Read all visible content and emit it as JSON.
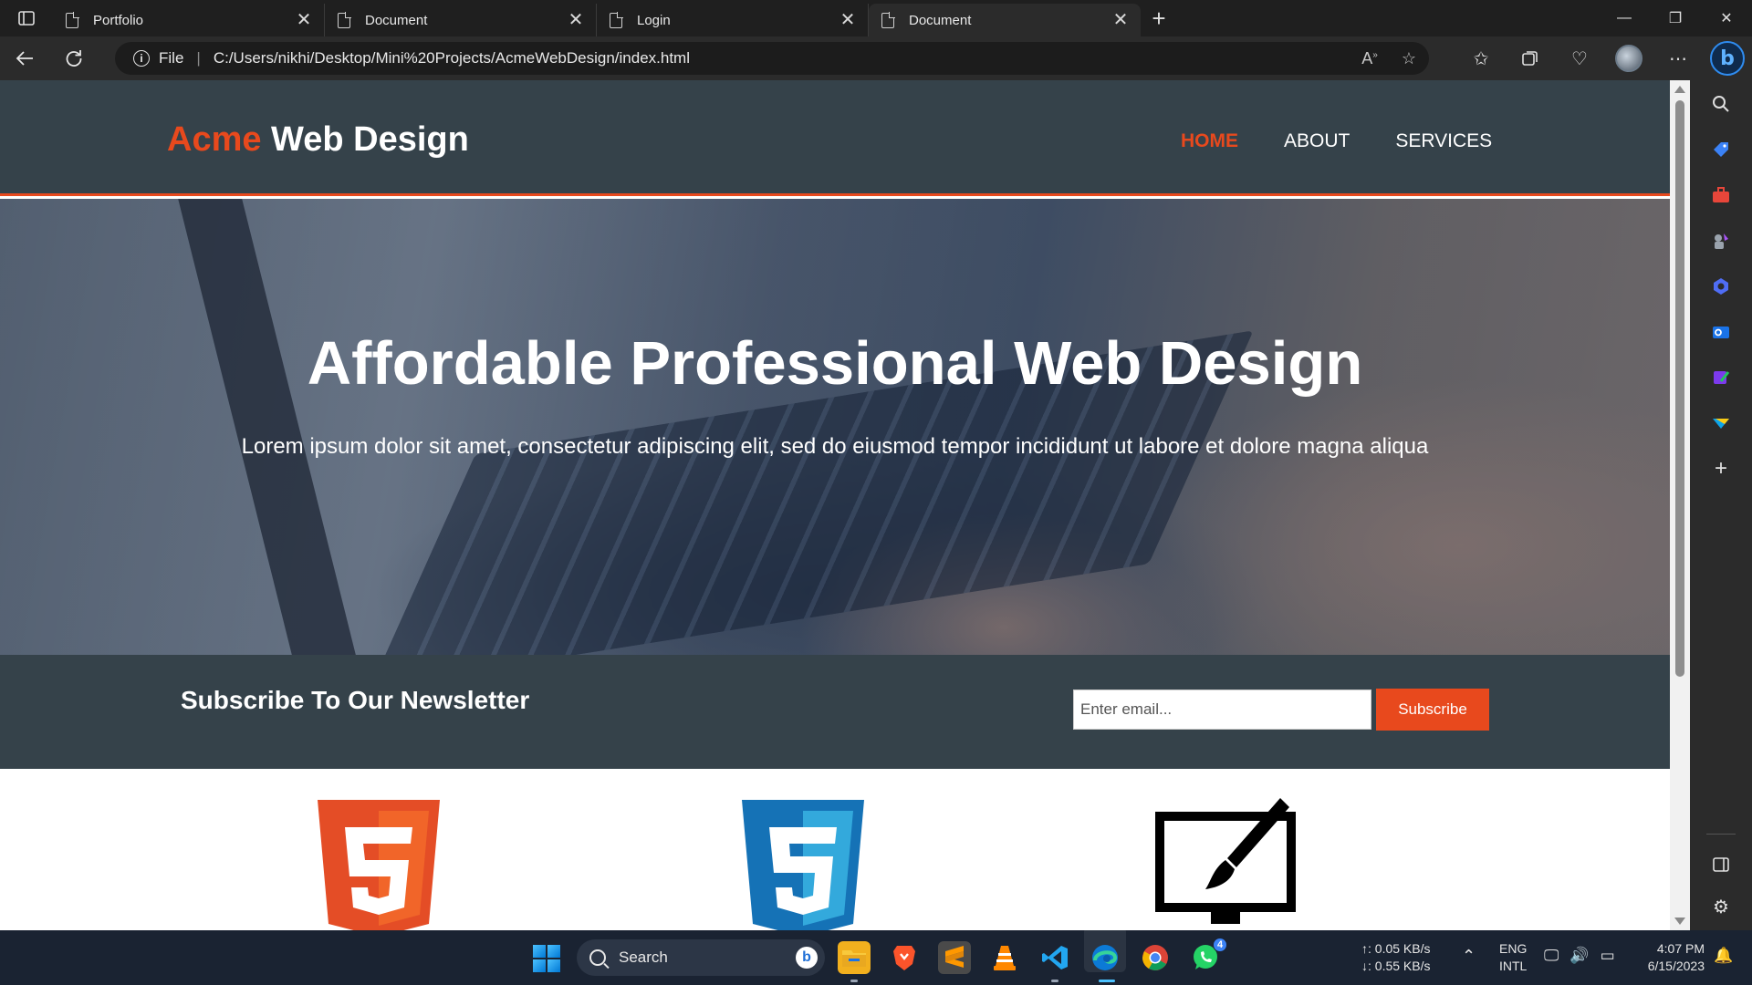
{
  "browser": {
    "tabs": [
      {
        "title": "Portfolio",
        "active": false
      },
      {
        "title": "Document",
        "active": false
      },
      {
        "title": "Login",
        "active": false
      },
      {
        "title": "Document",
        "active": true
      }
    ],
    "tab_close_glyph": "✕",
    "new_tab_glyph": "+",
    "window_controls": {
      "minimize": "—",
      "maximize": "❐",
      "close": "✕"
    },
    "address": {
      "scheme_label": "File",
      "url": "C:/Users/nikhi/Desktop/Mini%20Projects/AcmeWebDesign/index.html"
    },
    "icons": [
      "back-icon",
      "refresh-icon",
      "info-icon",
      "read-aloud-icon",
      "favorite-star-icon",
      "favorites-icon",
      "collections-icon",
      "browser-essentials-icon",
      "profile-avatar",
      "more-icon",
      "bing-copilot-icon"
    ]
  },
  "site": {
    "logo_highlight": "Acme",
    "logo_rest": " Web Design",
    "nav": [
      {
        "label": "Home",
        "current": true
      },
      {
        "label": "About",
        "current": false
      },
      {
        "label": "Services",
        "current": false
      }
    ],
    "showcase": {
      "title": "Affordable Professional Web Design",
      "text": "Lorem ipsum dolor sit amet, consectetur adipiscing elit, sed do eiusmod tempor incididunt ut labore et dolore magna aliqua"
    },
    "newsletter": {
      "title": "Subscribe To Our Newsletter",
      "email_placeholder": "Enter email...",
      "button_label": "Subscribe"
    },
    "boxes": [
      {
        "icon": "html5-logo-icon"
      },
      {
        "icon": "css3-logo-icon"
      },
      {
        "icon": "brush-monitor-icon"
      }
    ],
    "colors": {
      "header_bg": "#35424a",
      "accent": "#e8491d",
      "text": "#ffffff"
    }
  },
  "sidebar": {
    "icons": [
      "search-icon",
      "shopping-tag-icon",
      "tools-icon",
      "games-icon",
      "copilot-icon",
      "outlook-icon",
      "designer-icon",
      "drop-icon",
      "add-icon",
      "hide-sidebar-icon",
      "settings-icon"
    ]
  },
  "taskbar": {
    "search_label": "Search",
    "apps": [
      "file-explorer-icon",
      "brave-icon",
      "sublime-text-icon",
      "vlc-icon",
      "vscode-icon",
      "edge-icon",
      "chrome-icon",
      "whatsapp-icon"
    ],
    "whatsapp_badge": "4",
    "net_up": "↑: 0.05 KB/s",
    "net_down": "↓: 0.55 KB/s",
    "lang_line1": "ENG",
    "lang_line2": "INTL",
    "time": "4:07 PM",
    "date": "6/15/2023"
  }
}
